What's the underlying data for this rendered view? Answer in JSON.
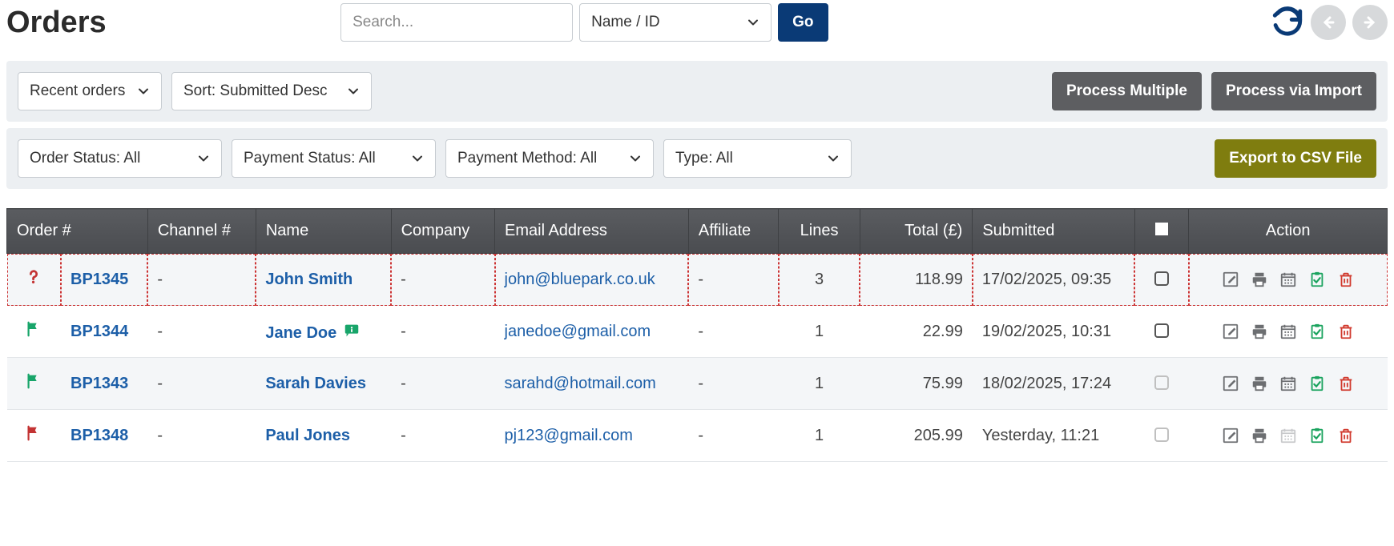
{
  "header": {
    "title": "Orders",
    "search_placeholder": "Search...",
    "search_field_label": "Name / ID",
    "go_label": "Go"
  },
  "toolbar1": {
    "recent_label": "Recent orders",
    "sort_label": "Sort: Submitted Desc",
    "process_multiple": "Process Multiple",
    "process_import": "Process via Import"
  },
  "toolbar2": {
    "order_status": "Order Status: All",
    "payment_status": "Payment Status: All",
    "payment_method": "Payment Method: All",
    "type": "Type: All",
    "export_csv": "Export to CSV File"
  },
  "columns": {
    "order_no": "Order #",
    "channel_no": "Channel #",
    "name": "Name",
    "company": "Company",
    "email": "Email Address",
    "affiliate": "Affiliate",
    "lines": "Lines",
    "total": "Total (£)",
    "submitted": "Submitted",
    "action": "Action"
  },
  "rows": [
    {
      "flag": "question",
      "flag_color": "#c33333",
      "order_no": "BP1345",
      "channel": "-",
      "name": "John Smith",
      "note": false,
      "company": "-",
      "email": "john@bluepark.co.uk",
      "affiliate": "-",
      "lines": "3",
      "total": "118.99",
      "submitted": "17/02/2025, 09:35",
      "checkbox_enabled": true,
      "calendar_enabled": true,
      "highlight": true,
      "zebra": true
    },
    {
      "flag": "flag",
      "flag_color": "#18a56a",
      "order_no": "BP1344",
      "channel": "-",
      "name": "Jane Doe",
      "note": true,
      "company": "-",
      "email": "janedoe@gmail.com",
      "affiliate": "-",
      "lines": "1",
      "total": "22.99",
      "submitted": "19/02/2025, 10:31",
      "checkbox_enabled": true,
      "calendar_enabled": true,
      "highlight": false,
      "zebra": false
    },
    {
      "flag": "flag",
      "flag_color": "#18a56a",
      "order_no": "BP1343",
      "channel": "-",
      "name": "Sarah Davies",
      "note": false,
      "company": "-",
      "email": "sarahd@hotmail.com",
      "affiliate": "-",
      "lines": "1",
      "total": "75.99",
      "submitted": "18/02/2025, 17:24",
      "checkbox_enabled": false,
      "calendar_enabled": true,
      "highlight": false,
      "zebra": true
    },
    {
      "flag": "flag",
      "flag_color": "#c33333",
      "order_no": "BP1348",
      "channel": "-",
      "name": "Paul Jones",
      "note": false,
      "company": "-",
      "email": "pj123@gmail.com",
      "affiliate": "-",
      "lines": "1",
      "total": "205.99",
      "submitted": "Yesterday, 11:21",
      "checkbox_enabled": false,
      "calendar_enabled": false,
      "highlight": false,
      "zebra": false
    }
  ],
  "icons": {
    "refresh": "refresh-icon",
    "prev": "arrow-left-icon",
    "next": "arrow-right-icon",
    "edit": "edit-icon",
    "print": "print-icon",
    "calendar": "calendar-icon",
    "tick_clip": "clipboard-check-icon",
    "delete": "trash-icon",
    "note": "speech-note-icon",
    "chevron": "chevron-down-icon"
  },
  "colors": {
    "link": "#1d5fa8",
    "uiblue": "#0a3a76",
    "uigrey": "#5d5e61",
    "olive": "#7f7d0f",
    "flag_green": "#18a56a",
    "flag_red": "#c33333",
    "action_grey": "#6c6e71",
    "action_green": "#1aa35e",
    "action_red": "#d13a2e"
  }
}
